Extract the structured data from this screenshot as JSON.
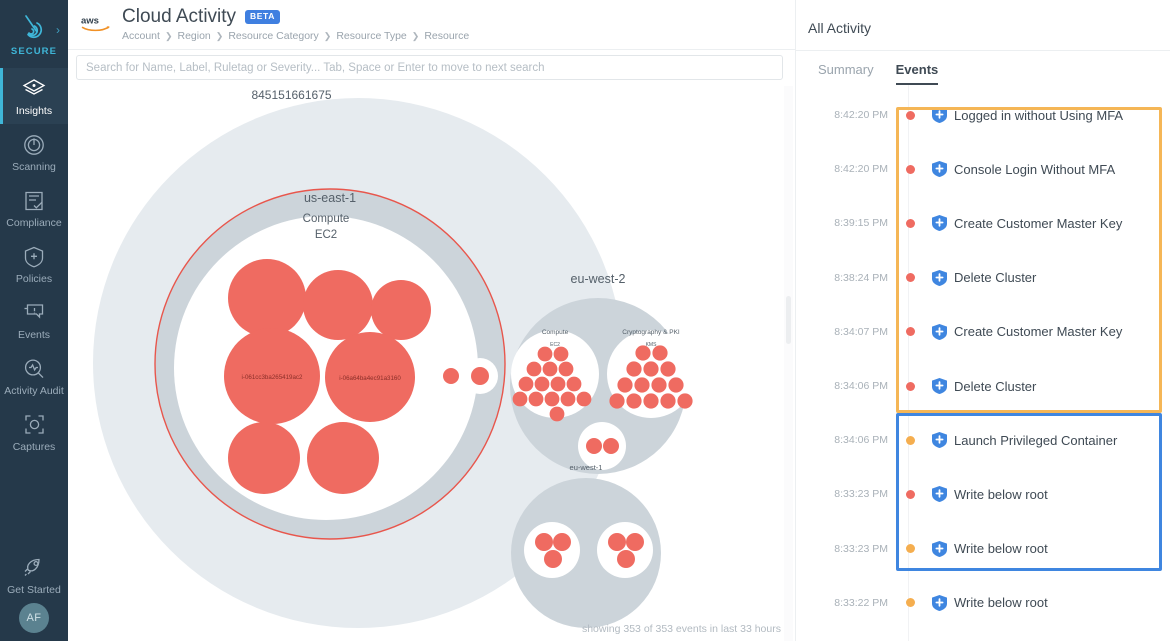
{
  "sidebar": {
    "brand": {
      "label": "SECURE",
      "icon": "sysdig-logo-icon",
      "caret": "›"
    },
    "items": [
      {
        "label": "Insights",
        "icon": "layers-icon",
        "active": true
      },
      {
        "label": "Scanning",
        "icon": "power-scan-icon",
        "active": false
      },
      {
        "label": "Compliance",
        "icon": "clipboard-check-icon",
        "active": false
      },
      {
        "label": "Policies",
        "icon": "shield-plus-icon",
        "active": false
      },
      {
        "label": "Events",
        "icon": "speech-alert-icon",
        "active": false
      },
      {
        "label": "Activity Audit",
        "icon": "magnifier-pulse-icon",
        "active": false
      },
      {
        "label": "Captures",
        "icon": "capture-frame-icon",
        "active": false
      }
    ],
    "footer_item": {
      "label": "Get Started",
      "icon": "rocket-icon"
    },
    "avatar": {
      "initials": "AF"
    }
  },
  "header": {
    "cloud_logo": "aws-logo-icon",
    "title": "Cloud Activity",
    "badge": "BETA",
    "breadcrumb": [
      "Account",
      "Region",
      "Resource Category",
      "Resource Type",
      "Resource"
    ],
    "breadcrumb_separator": "❯"
  },
  "search": {
    "value": "",
    "placeholder": "Search for Name, Label, Ruletag or Severity... Tab, Space or Enter to move to next search"
  },
  "chart": {
    "account_id": "845151661675",
    "footnote": "showing 353 of 353 events in last 33 hours",
    "colors": {
      "bubble": "#ef6b61",
      "outer_ring": "#e6ebef",
      "region_ring": "#ccd4da",
      "inner_fill": "#ffffff",
      "selected_stroke": "#e8564c"
    },
    "regions": [
      {
        "name": "us-east-1",
        "selected": true,
        "categories": [
          {
            "name": "Compute",
            "type": "EC2",
            "resources": [
              {
                "label": "",
                "size": "large"
              },
              {
                "label": "",
                "size": "large"
              },
              {
                "label": "",
                "size": "medium"
              },
              {
                "label": "i-061cc3ba265419ac2",
                "size": "xlarge"
              },
              {
                "label": "i-06a64ba4ec91a3160",
                "size": "xlarge"
              },
              {
                "label": "",
                "size": "large"
              },
              {
                "label": "",
                "size": "large"
              }
            ]
          }
        ],
        "loose_resources": 2
      },
      {
        "name": "eu-west-2",
        "selected": false,
        "categories": [
          {
            "name": "Compute",
            "type": "EC2",
            "bubble_count": 16
          },
          {
            "name": "Cryptography & PKI",
            "type": "KMS",
            "bubble_count": 15
          },
          {
            "name": "",
            "type": "",
            "bubble_count": 2
          }
        ]
      },
      {
        "name": "eu-west-1",
        "selected": false,
        "categories": [
          {
            "name": "",
            "type": "",
            "bubble_count": 3
          },
          {
            "name": "",
            "type": "",
            "bubble_count": 3
          }
        ]
      }
    ]
  },
  "right_panel": {
    "title": "All Activity",
    "tabs": [
      {
        "label": "Summary",
        "active": false
      },
      {
        "label": "Events",
        "active": true
      }
    ],
    "severity_colors": {
      "high": "#ef6b61",
      "medium": "#f5ae4f"
    },
    "highlight_colors": {
      "orange": "#f5b656",
      "blue": "#3f86e0"
    },
    "events": [
      {
        "time": "8:42:20 PM",
        "severity": "high",
        "name": "Logged in without Using MFA"
      },
      {
        "time": "8:42:20 PM",
        "severity": "high",
        "name": "Console Login Without MFA"
      },
      {
        "time": "8:39:15 PM",
        "severity": "high",
        "name": "Create Customer Master Key"
      },
      {
        "time": "8:38:24 PM",
        "severity": "high",
        "name": "Delete Cluster"
      },
      {
        "time": "8:34:07 PM",
        "severity": "high",
        "name": "Create Customer Master Key"
      },
      {
        "time": "8:34:06 PM",
        "severity": "high",
        "name": "Delete Cluster"
      },
      {
        "time": "8:34:06 PM",
        "severity": "medium",
        "name": "Launch Privileged Container"
      },
      {
        "time": "8:33:23 PM",
        "severity": "high",
        "name": "Write below root"
      },
      {
        "time": "8:33:23 PM",
        "severity": "medium",
        "name": "Write below root"
      },
      {
        "time": "8:33:22 PM",
        "severity": "medium",
        "name": "Write below root"
      }
    ]
  }
}
